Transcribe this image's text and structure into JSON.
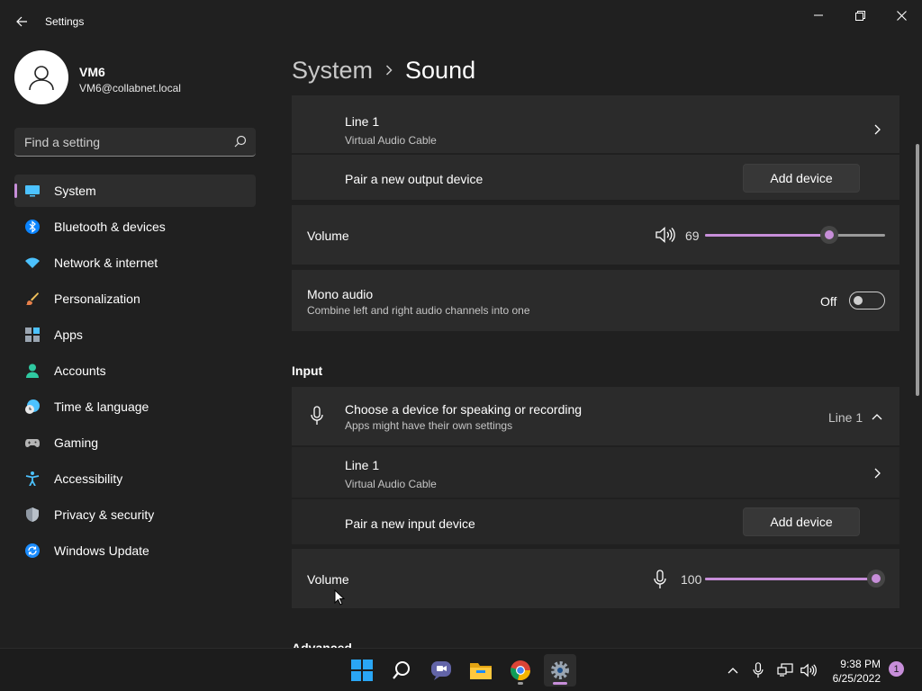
{
  "window": {
    "title": "Settings"
  },
  "profile": {
    "name": "VM6",
    "email": "VM6@collabnet.local"
  },
  "search": {
    "placeholder": "Find a setting"
  },
  "sidebar": {
    "items": [
      {
        "label": "System",
        "icon": "system-icon",
        "active": true
      },
      {
        "label": "Bluetooth & devices",
        "icon": "bluetooth-icon"
      },
      {
        "label": "Network & internet",
        "icon": "wifi-icon"
      },
      {
        "label": "Personalization",
        "icon": "brush-icon"
      },
      {
        "label": "Apps",
        "icon": "apps-icon"
      },
      {
        "label": "Accounts",
        "icon": "accounts-icon"
      },
      {
        "label": "Time & language",
        "icon": "clock-globe-icon"
      },
      {
        "label": "Gaming",
        "icon": "gamepad-icon"
      },
      {
        "label": "Accessibility",
        "icon": "accessibility-icon"
      },
      {
        "label": "Privacy & security",
        "icon": "shield-icon"
      },
      {
        "label": "Windows Update",
        "icon": "update-icon"
      }
    ]
  },
  "breadcrumb": {
    "parent": "System",
    "current": "Sound"
  },
  "output": {
    "device": {
      "name": "Line 1",
      "subtitle": "Virtual Audio Cable"
    },
    "pair": {
      "label": "Pair a new output device",
      "button": "Add device"
    },
    "volume": {
      "label": "Volume",
      "value": "69",
      "level": 69
    },
    "mono": {
      "label": "Mono audio",
      "subtitle": "Combine left and right audio channels into one",
      "state": "Off"
    }
  },
  "input": {
    "section_title": "Input",
    "choose": {
      "label": "Choose a device for speaking or recording",
      "subtitle": "Apps might have their own settings",
      "selected": "Line 1"
    },
    "device": {
      "name": "Line 1",
      "subtitle": "Virtual Audio Cable"
    },
    "pair": {
      "label": "Pair a new input device",
      "button": "Add device"
    },
    "volume": {
      "label": "Volume",
      "value": "100",
      "level": 100
    }
  },
  "advanced": {
    "section_title": "Advanced"
  },
  "taskbar": {
    "apps": [
      "windows-start-icon",
      "search-icon",
      "teams-chat-icon",
      "file-explorer-icon",
      "chrome-icon",
      "settings-gear-icon"
    ],
    "time": "9:38 PM",
    "date": "6/25/2022",
    "notification_count": "1"
  },
  "colors": {
    "accent": "#c78ed9",
    "background": "#202020",
    "card": "#2b2b2b"
  }
}
